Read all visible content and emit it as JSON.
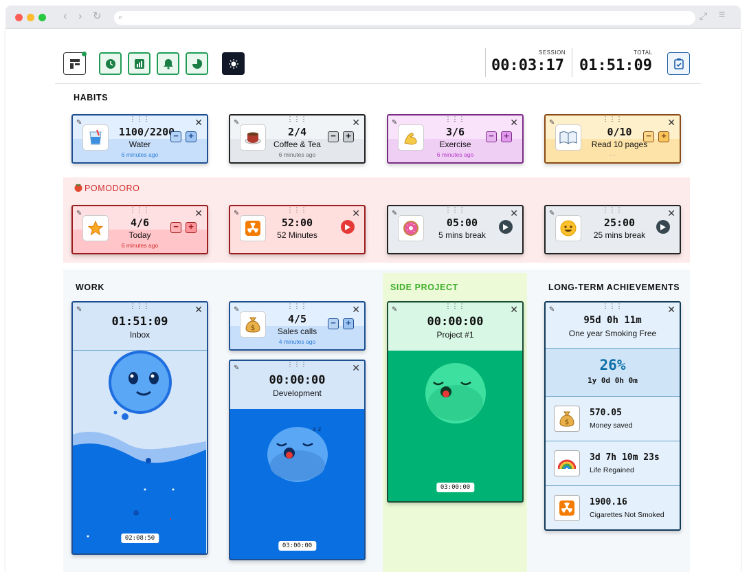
{
  "toolbar": {
    "session_label": "SESSION",
    "session_time": "00:03:17",
    "total_label": "TOTAL",
    "total_time": "01:51:09"
  },
  "sections": {
    "habits": "HABITS",
    "pomodoro": "POMODORO",
    "work": "WORK",
    "side_project": "SIDE PROJECT",
    "long_term": "LONG-TERM ACHIEVEMENTS"
  },
  "habits": [
    {
      "value": "1100/2200",
      "label": "Water",
      "ago": "6 minutes ago",
      "icon": "water-glass-icon"
    },
    {
      "value": "2/4",
      "label": "Coffee & Tea",
      "ago": "6 minutes ago",
      "icon": "coffee-icon"
    },
    {
      "value": "3/6",
      "label": "Exercise",
      "ago": "6 minutes ago",
      "icon": "flexed-arm-icon"
    },
    {
      "value": "0/10",
      "label": "Read 10 pages",
      "ago": "- -",
      "icon": "book-icon"
    }
  ],
  "pomodoro": [
    {
      "value": "4/6",
      "label": "Today",
      "ago": "6 minutes ago",
      "icon": "star-icon"
    },
    {
      "value": "52:00",
      "label": "52 Minutes",
      "icon": "radioactive-icon"
    },
    {
      "value": "05:00",
      "label": "5 mins break",
      "icon": "donut-icon"
    },
    {
      "value": "25:00",
      "label": "25 mins break",
      "icon": "smiley-icon"
    }
  ],
  "work": {
    "inbox": {
      "time": "01:51:09",
      "label": "Inbox",
      "remaining": "02:08:50",
      "progress": 0.46
    },
    "sales": {
      "value": "4/5",
      "label": "Sales calls",
      "ago": "4 minutes ago",
      "icon": "money-bag-icon"
    },
    "development": {
      "time": "00:00:00",
      "label": "Development",
      "remaining": "03:00:00"
    }
  },
  "side_project": {
    "time": "00:00:00",
    "label": "Project #1",
    "remaining": "03:00:00"
  },
  "achievements": {
    "header_value": "95d 0h 11m",
    "header_label": "One year Smoking Free",
    "percent": "26%",
    "percent_sub": "1y 0d 0h 0m",
    "items": [
      {
        "value": "570.05",
        "label": "Money saved",
        "icon": "money-bag-icon"
      },
      {
        "value": "3d 7h 10m 23s",
        "label": "Life Regained",
        "icon": "rainbow-icon"
      },
      {
        "value": "1900.16",
        "label": "Cigarettes Not Smoked",
        "icon": "radioactive-icon"
      }
    ]
  },
  "colors": {
    "water": "#cde3fb",
    "water_border": "#1d4f91",
    "coffee": "#e8ecf0",
    "exercise": "#f3d6f7",
    "exercise_border": "#7b2d86",
    "read": "#fde7b8",
    "read_border": "#8a4b16",
    "pomodoro_bg": "#fde8e8",
    "pomodoro_red": "#ffc9cc",
    "pomodoro_border": "#9b1c1c",
    "green": "#00b374",
    "blue": "#0a6fe0"
  }
}
